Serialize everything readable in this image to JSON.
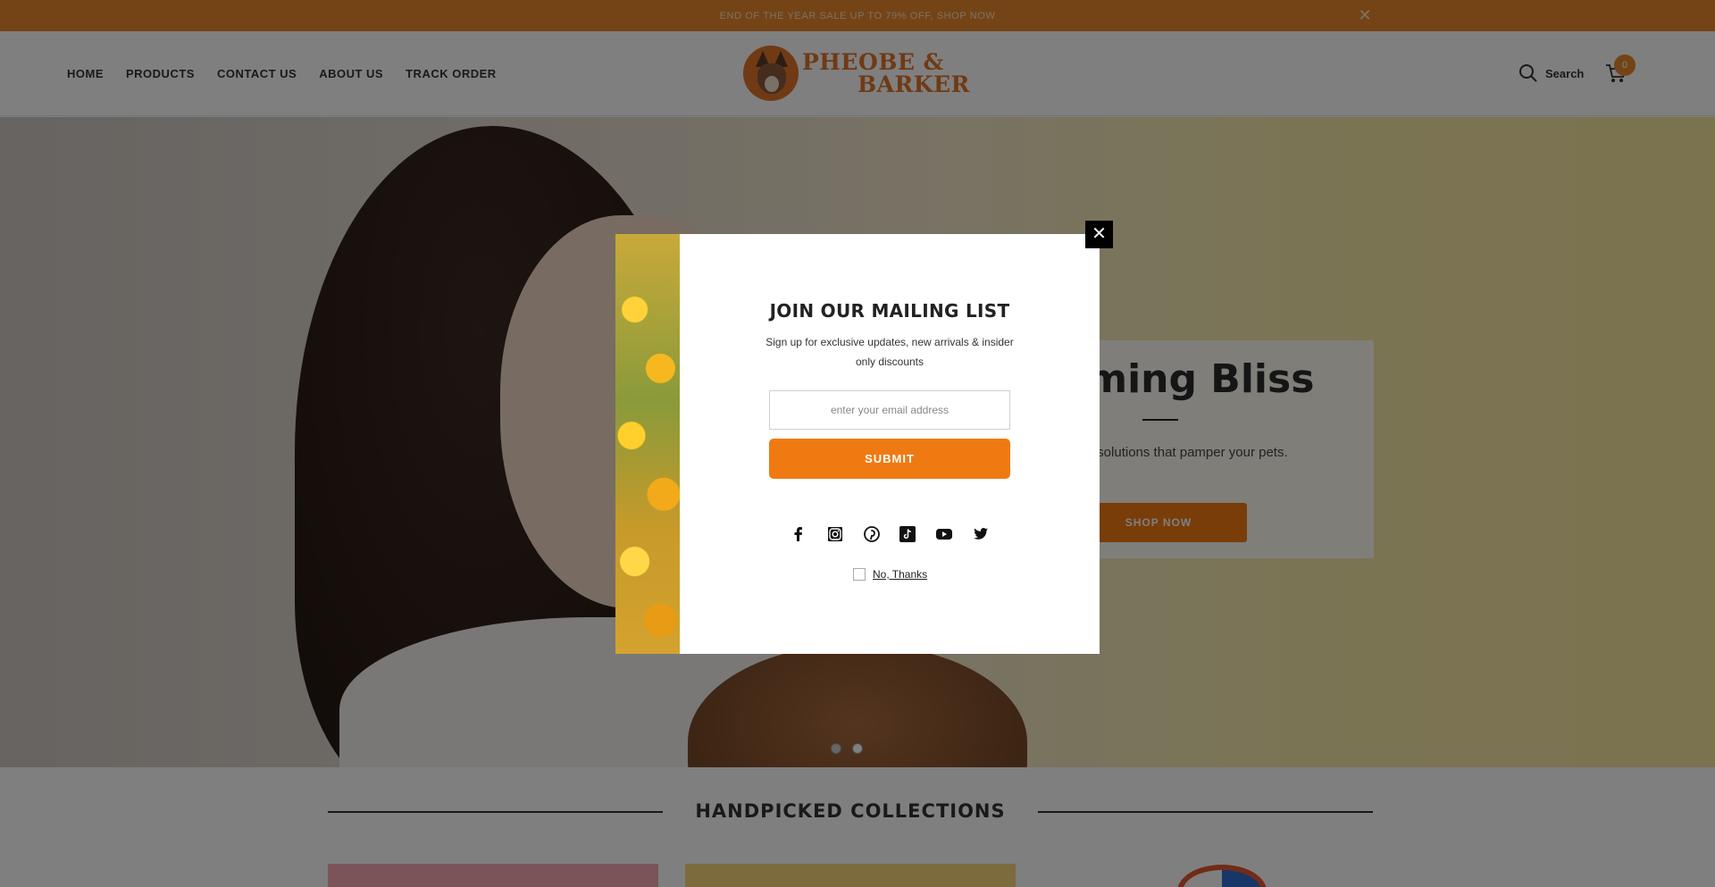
{
  "announcement": {
    "text": "END OF THE YEAR SALE UP TO 79% OFF, SHOP NOW"
  },
  "nav": {
    "items": [
      {
        "label": "HOME"
      },
      {
        "label": "PRODUCTS"
      },
      {
        "label": "CONTACT US"
      },
      {
        "label": "ABOUT US"
      },
      {
        "label": "TRACK ORDER"
      }
    ]
  },
  "brand": {
    "line1": "PHEOBE &",
    "line2": "BARKER",
    "color": "#e0752a"
  },
  "header": {
    "search_label": "Search",
    "cart_count": "0"
  },
  "hero": {
    "title": "oming Bliss",
    "subtitle": "ing solutions that pamper your pets.",
    "button_label": "SHOP NOW",
    "slides": [
      {
        "active": true
      },
      {
        "active": false
      }
    ]
  },
  "collections": {
    "title": "HANDPICKED COLLECTIONS"
  },
  "popup": {
    "title": "JOIN OUR MAILING LIST",
    "subtitle": "Sign up for exclusive updates, new arrivals & insider only discounts",
    "email_placeholder": "enter your email address",
    "email_value": "",
    "submit_label": "SUBMIT",
    "decline_label": "No, Thanks",
    "social_icons": [
      "facebook-icon",
      "instagram-icon",
      "pinterest-icon",
      "tiktok-icon",
      "youtube-icon",
      "twitter-icon"
    ]
  },
  "colors": {
    "accent": "#f07a12",
    "announcement_bg": "#e8892c",
    "overlay": "rgba(0,0,0,0.5)"
  }
}
